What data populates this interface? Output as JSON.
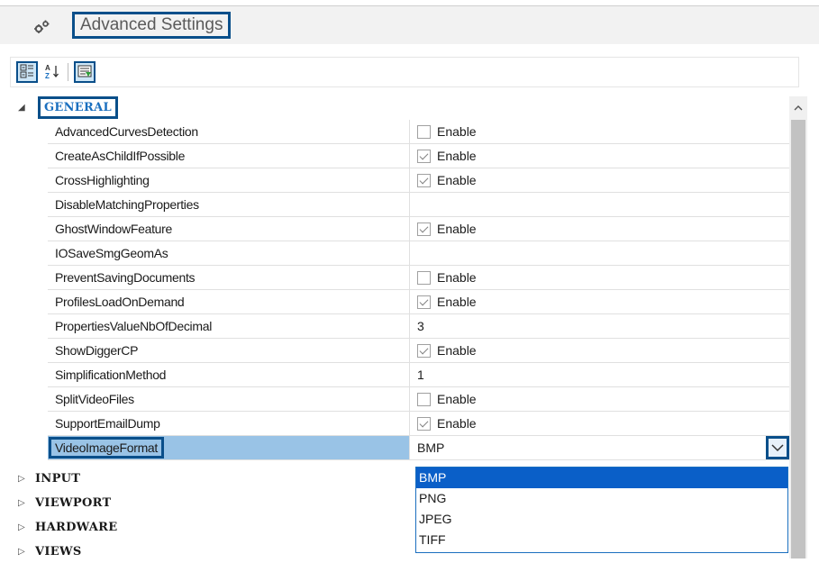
{
  "window": {
    "title": "Advanced Settings",
    "accent_color": "#0a4f8a",
    "selection_color": "#0a5fc8"
  },
  "toolbar": {
    "buttons": [
      {
        "icon": "categorized-icon",
        "active": true
      },
      {
        "icon": "sort-alphabetical-icon",
        "active": false
      },
      {
        "icon": "property-pages-icon",
        "active": true
      }
    ]
  },
  "categories": [
    {
      "label": "GENERAL",
      "expanded": true
    },
    {
      "label": "INPUT",
      "expanded": false
    },
    {
      "label": "VIEWPORT",
      "expanded": false
    },
    {
      "label": "HARDWARE",
      "expanded": false
    },
    {
      "label": "VIEWS",
      "expanded": false
    }
  ],
  "properties": [
    {
      "name": "AdvancedCurvesDetection",
      "value": "Enable",
      "checkbox": true,
      "checked": false
    },
    {
      "name": "CreateAsChildIfPossible",
      "value": "Enable",
      "checkbox": true,
      "checked": true
    },
    {
      "name": "CrossHighlighting",
      "value": "Enable",
      "checkbox": true,
      "checked": true
    },
    {
      "name": "DisableMatchingProperties",
      "value": "",
      "checkbox": false
    },
    {
      "name": "GhostWindowFeature",
      "value": "Enable",
      "checkbox": true,
      "checked": true
    },
    {
      "name": "IOSaveSmgGeomAs",
      "value": "",
      "checkbox": false
    },
    {
      "name": "PreventSavingDocuments",
      "value": "Enable",
      "checkbox": true,
      "checked": false
    },
    {
      "name": "ProfilesLoadOnDemand",
      "value": "Enable",
      "checkbox": true,
      "checked": true
    },
    {
      "name": "PropertiesValueNbOfDecimal",
      "value": "3",
      "checkbox": false
    },
    {
      "name": "ShowDiggerCP",
      "value": "Enable",
      "checkbox": true,
      "checked": true
    },
    {
      "name": "SimplificationMethod",
      "value": "1",
      "checkbox": false
    },
    {
      "name": "SplitVideoFiles",
      "value": "Enable",
      "checkbox": true,
      "checked": false
    },
    {
      "name": "SupportEmailDump",
      "value": "Enable",
      "checkbox": true,
      "checked": true
    },
    {
      "name": "VideoImageFormat",
      "value": "BMP",
      "checkbox": false,
      "dropdown": true,
      "selected": true
    }
  ],
  "dropdown": {
    "options": [
      "BMP",
      "PNG",
      "JPEG",
      "TIFF"
    ],
    "highlighted": "BMP"
  }
}
